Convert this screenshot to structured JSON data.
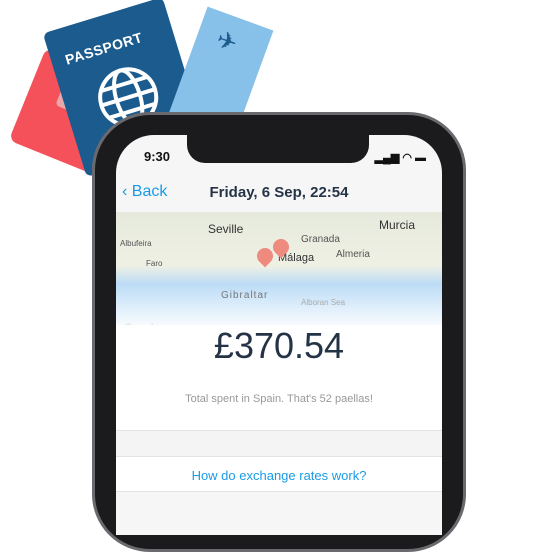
{
  "illustration": {
    "passport_label": "PASSPORT"
  },
  "status_bar": {
    "time": "9:30"
  },
  "nav": {
    "back_label": "Back",
    "title": "Friday, 6 Sep, 22:54"
  },
  "map": {
    "labels": [
      "Seville",
      "Granada",
      "Murcia",
      "Albufeira",
      "Faro",
      "Málaga",
      "Almeria",
      "Gibraltar",
      "Alboran Sea",
      "Google"
    ]
  },
  "summary": {
    "amount": "£370.54",
    "caption": "Total spent in Spain. That's 52 paellas!"
  },
  "link": {
    "label": "How do exchange rates work?"
  },
  "colors": {
    "accent": "#1a9be6",
    "text": "#253347",
    "card": "#f5515a",
    "passport": "#1b5b8e"
  }
}
